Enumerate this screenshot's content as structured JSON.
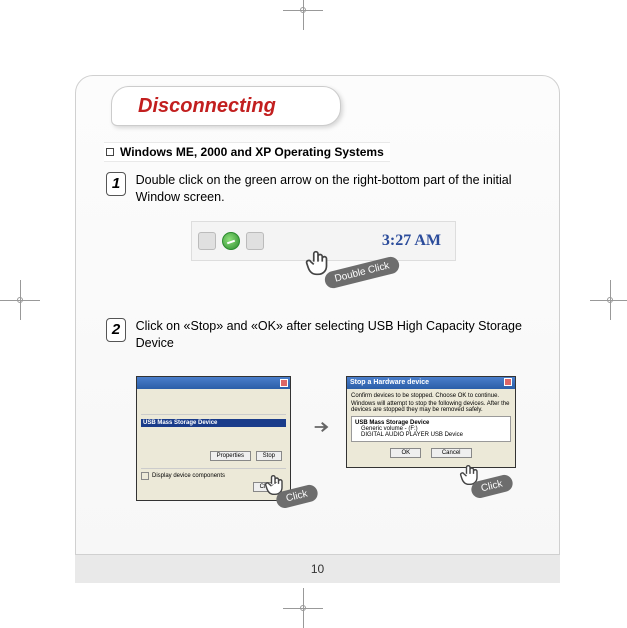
{
  "title": "Disconnecting",
  "section": "Windows ME, 2000 and XP Operating Systems",
  "steps": {
    "s1": {
      "num": "1",
      "text": "Double click on the green arrow on the right-bottom part of the initial Window screen."
    },
    "s2": {
      "num": "2",
      "text": "Click on «Stop» and «OK» after selecting USB High Capacity Storage Device"
    }
  },
  "taskbar": {
    "time": "3:27 AM"
  },
  "labels": {
    "double_click": "Double Click",
    "click": "Click"
  },
  "dialog2": {
    "title": "Stop a Hardware device",
    "msg1": "Confirm devices to be stopped. Choose OK to continue.",
    "msg2": "Windows will attempt to stop the following devices. After the devices are stopped they may be removed safely.",
    "item1": "USB Mass Storage Device",
    "item2": "Generic volume - (F:)",
    "item3": "DIGITAL AUDIO PLAYER USB Device",
    "ok": "OK",
    "cancel": "Cancel"
  },
  "dialog1": {
    "row": "USB Mass Storage Device",
    "stop": "Stop",
    "close": "Close",
    "properties": "Properties"
  },
  "page_number": "10"
}
